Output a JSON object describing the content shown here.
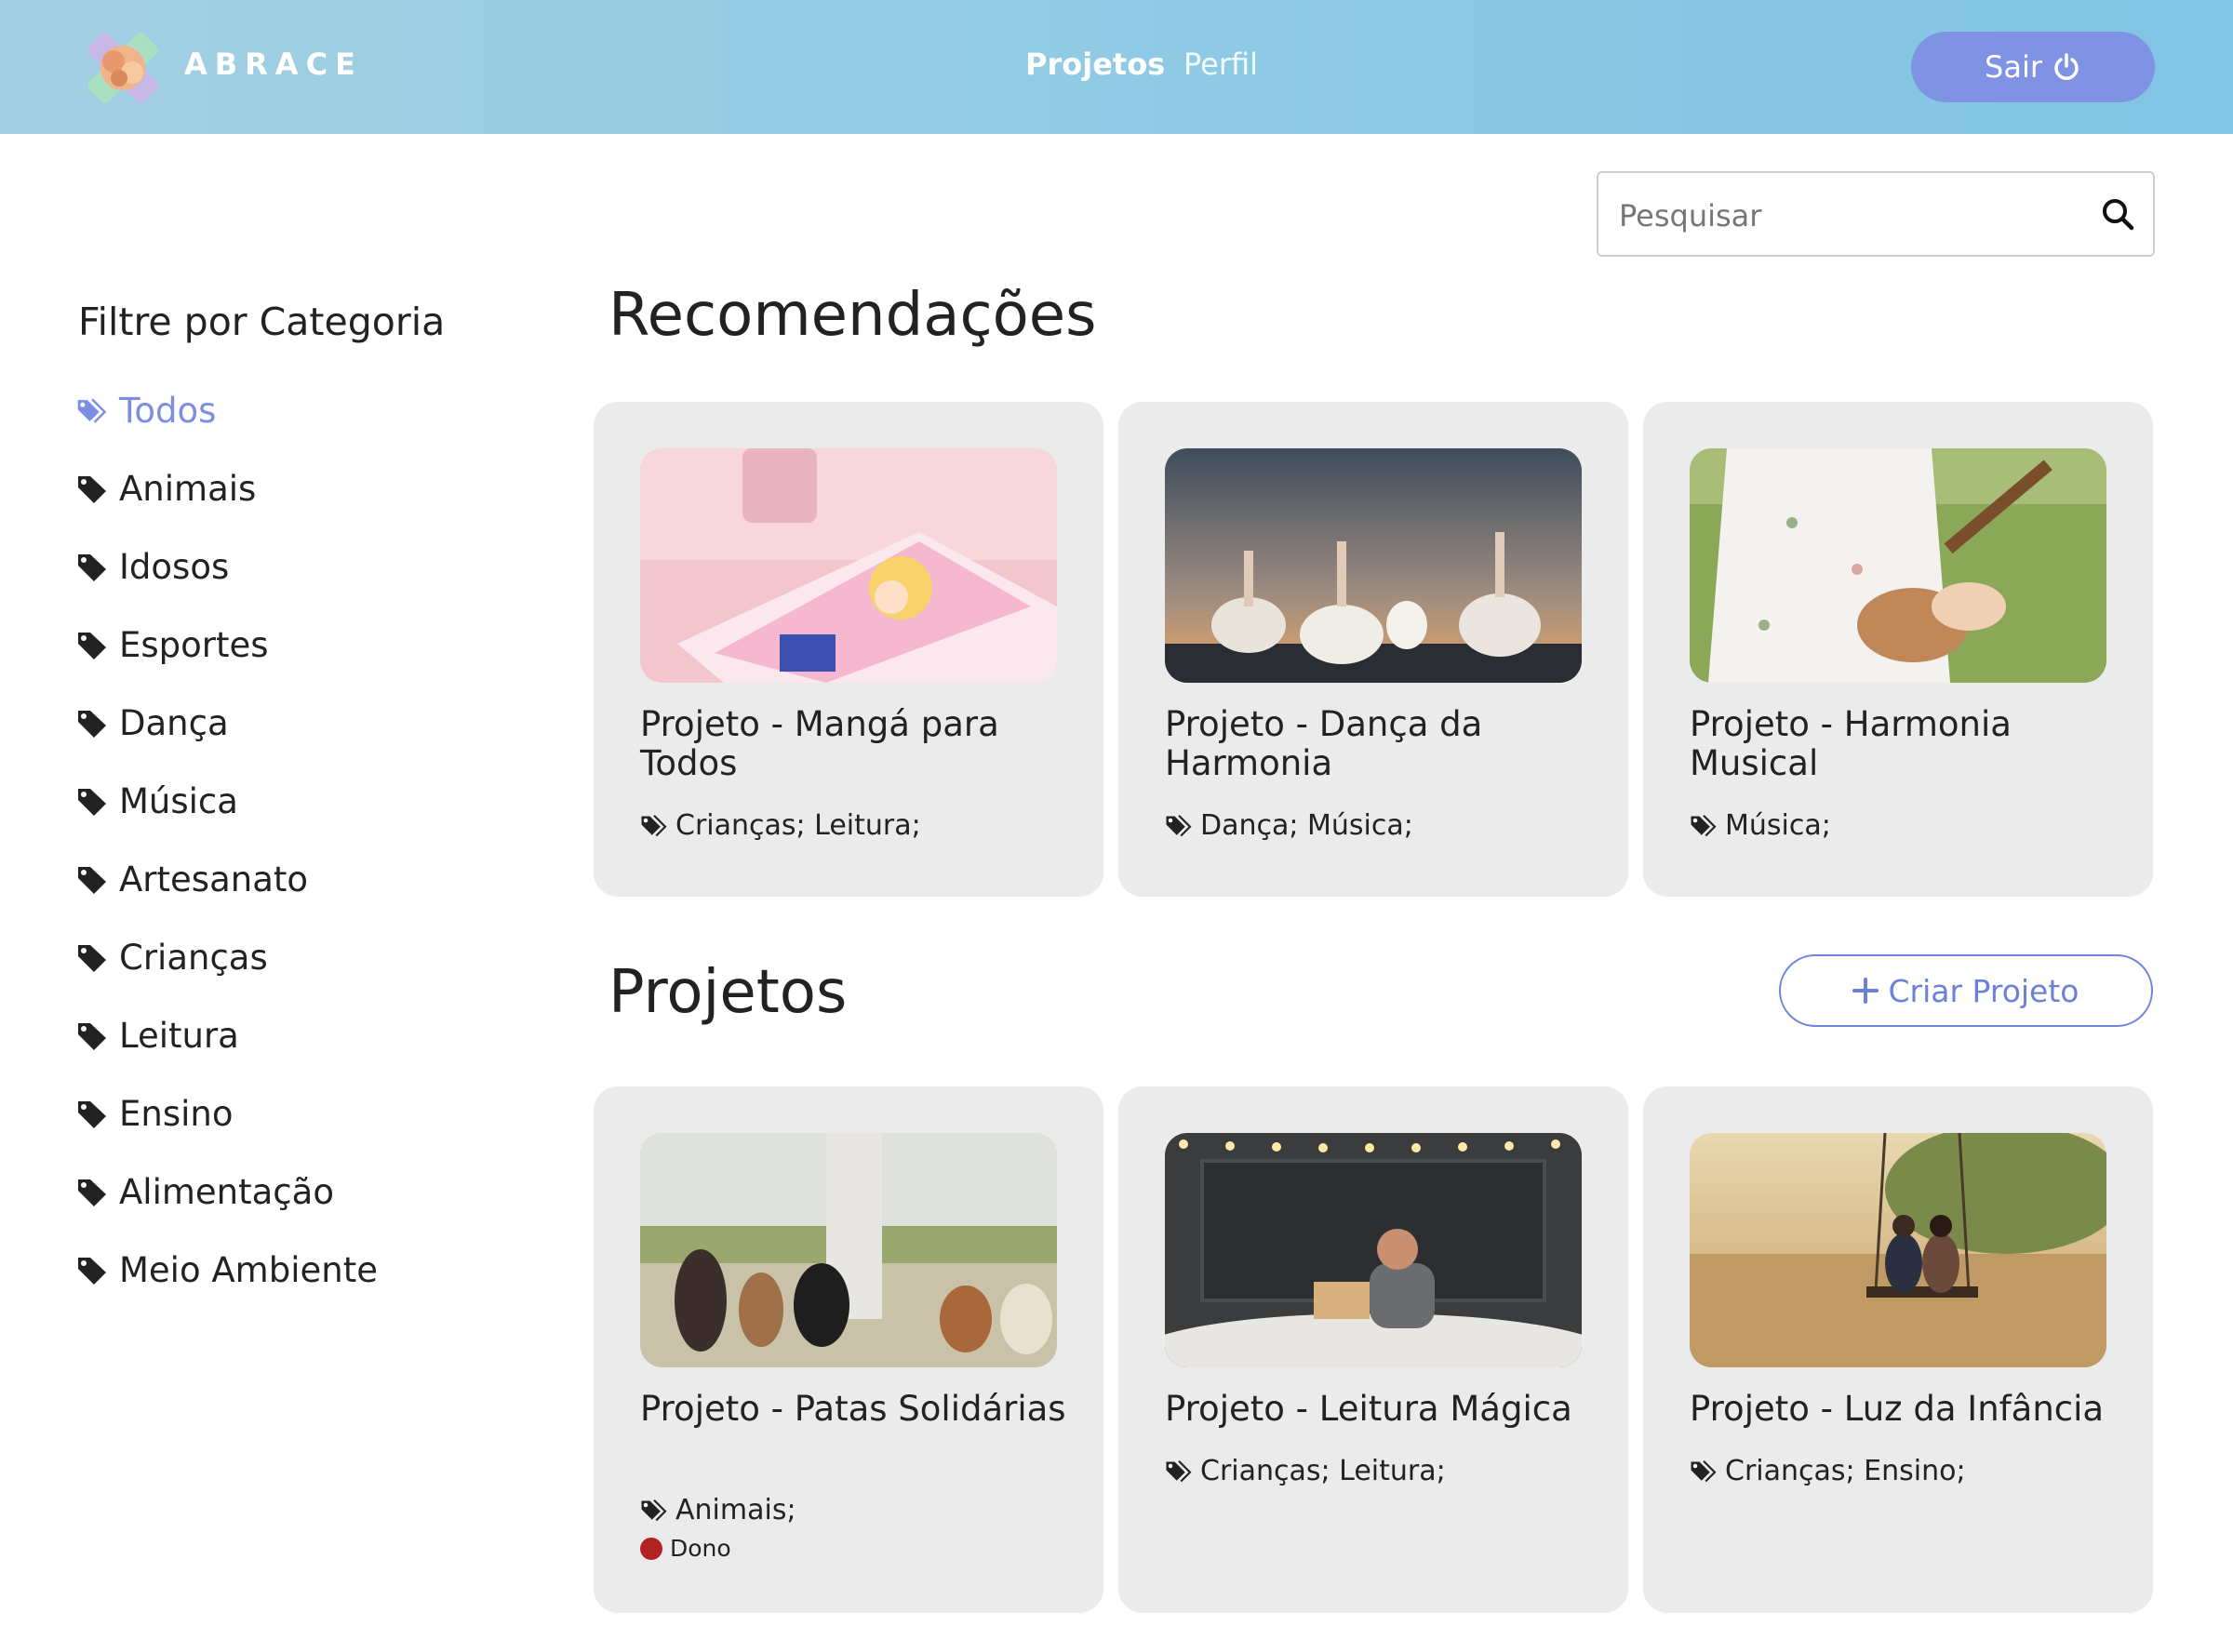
{
  "header": {
    "logo_text": "ABRACE",
    "nav": [
      {
        "label": "Projetos"
      },
      {
        "label": "Perfil"
      }
    ],
    "logout_label": "Sair"
  },
  "search": {
    "placeholder": "Pesquisar"
  },
  "sidebar": {
    "title": "Filtre por Categoria",
    "categories": [
      {
        "label": "Todos",
        "active": true
      },
      {
        "label": "Animais"
      },
      {
        "label": "Idosos"
      },
      {
        "label": "Esportes"
      },
      {
        "label": "Dança"
      },
      {
        "label": "Música"
      },
      {
        "label": "Artesanato"
      },
      {
        "label": "Crianças"
      },
      {
        "label": "Leitura"
      },
      {
        "label": "Ensino"
      },
      {
        "label": "Alimentação"
      },
      {
        "label": "Meio Ambiente"
      }
    ]
  },
  "recommendations": {
    "title": "Recomendações",
    "cards": [
      {
        "title": "Projeto - Mangá para Todos",
        "tags": "Crianças; Leitura;",
        "image": "manga-book-photo"
      },
      {
        "title": "Projeto - Dança da Harmonia",
        "tags": "Dança; Música;",
        "image": "ballet-dancers-photo"
      },
      {
        "title": "Projeto - Harmonia Musical",
        "tags": "Música;",
        "image": "ukulele-player-photo"
      }
    ]
  },
  "projects": {
    "title": "Projetos",
    "create_label": "Criar Projeto",
    "cards": [
      {
        "title": "Projeto - Patas Solidárias",
        "tags": "Animais;",
        "owner_label": "Dono",
        "image": "dog-walker-photo"
      },
      {
        "title": "Projeto - Leitura Mágica",
        "tags": "Crianças; Leitura;",
        "image": "child-reading-photo"
      },
      {
        "title": "Projeto - Luz da Infância",
        "tags": "Crianças; Ensino;",
        "image": "children-swing-photo"
      }
    ]
  },
  "colors": {
    "accent": "#7f92e4",
    "active_category": "#7b8ee2",
    "card_bg": "#ebebeb",
    "owner_dot": "#b22222"
  }
}
